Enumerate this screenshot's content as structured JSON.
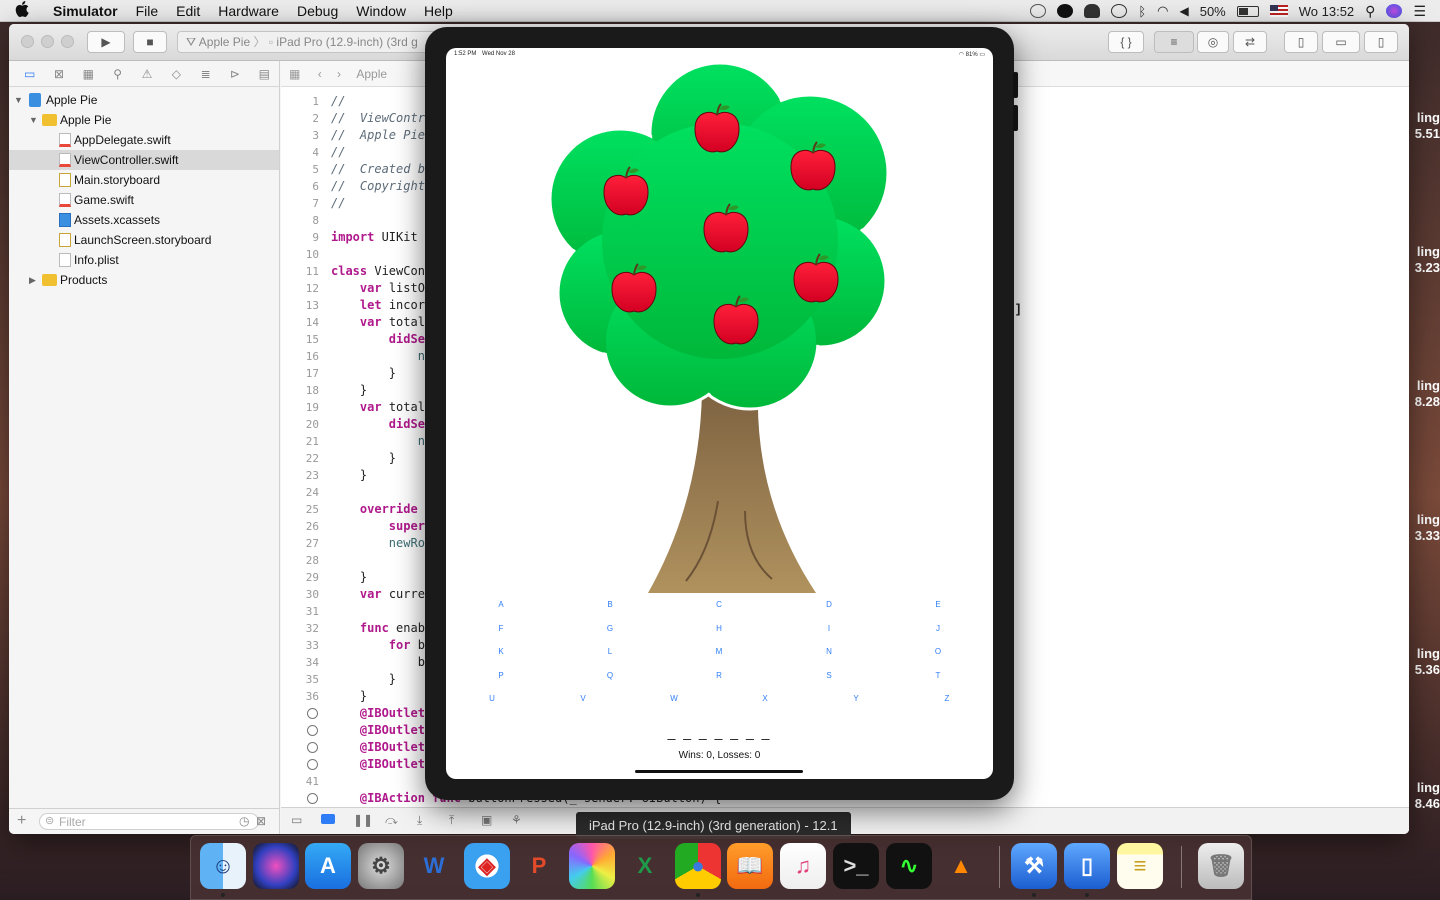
{
  "menubar": {
    "apple": "",
    "app": "Simulator",
    "items": [
      "File",
      "Edit",
      "Hardware",
      "Debug",
      "Window",
      "Help"
    ],
    "battery": "50%",
    "clock": "Wo 13:52"
  },
  "xcode": {
    "scheme": "Apple Pie",
    "device": "iPad Pro (12.9-inch) (3rd g",
    "jump_file": "Apple",
    "filter_placeholder": "Filter",
    "navigator": [
      {
        "label": "Apple Pie",
        "kind": "proj",
        "depth": 0,
        "open": true
      },
      {
        "label": "Apple Pie",
        "kind": "folder",
        "depth": 1,
        "open": true
      },
      {
        "label": "AppDelegate.swift",
        "kind": "swift",
        "depth": 2
      },
      {
        "label": "ViewController.swift",
        "kind": "swift",
        "depth": 2,
        "selected": true
      },
      {
        "label": "Main.storyboard",
        "kind": "sb",
        "depth": 2
      },
      {
        "label": "Game.swift",
        "kind": "swift",
        "depth": 2
      },
      {
        "label": "Assets.xcassets",
        "kind": "xc",
        "depth": 2
      },
      {
        "label": "LaunchScreen.storyboard",
        "kind": "sb",
        "depth": 2
      },
      {
        "label": "Info.plist",
        "kind": "plist",
        "depth": 2
      },
      {
        "label": "Products",
        "kind": "folder",
        "depth": 1,
        "open": false
      }
    ],
    "code": [
      {
        "n": "1",
        "html": "<span class='cm'>//</span>"
      },
      {
        "n": "2",
        "html": "<span class='cm'>//  ViewContr</span>"
      },
      {
        "n": "3",
        "html": "<span class='cm'>//  Apple Pie</span>"
      },
      {
        "n": "4",
        "html": "<span class='cm'>//</span>"
      },
      {
        "n": "5",
        "html": "<span class='cm'>//  Created b</span>"
      },
      {
        "n": "6",
        "html": "<span class='cm'>//  Copyright</span>"
      },
      {
        "n": "7",
        "html": "<span class='cm'>//</span>"
      },
      {
        "n": "8",
        "html": ""
      },
      {
        "n": "9",
        "html": "<span class='kw'>import</span> UIKit"
      },
      {
        "n": "10",
        "html": ""
      },
      {
        "n": "11",
        "html": "<span class='kw'>class</span> ViewCon"
      },
      {
        "n": "12",
        "html": "    <span class='kw'>var</span> listO"
      },
      {
        "n": "13",
        "html": "    <span class='kw'>let</span> incor"
      },
      {
        "n": "14",
        "html": "    <span class='kw'>var</span> total"
      },
      {
        "n": "15",
        "html": "        <span class='kw'>didSe</span>"
      },
      {
        "n": "16",
        "html": "            <span class='fn'>n</span>"
      },
      {
        "n": "17",
        "html": "        }"
      },
      {
        "n": "18",
        "html": "    }"
      },
      {
        "n": "19",
        "html": "    <span class='kw'>var</span> total"
      },
      {
        "n": "20",
        "html": "        <span class='kw'>didSe</span>"
      },
      {
        "n": "21",
        "html": "            <span class='fn'>n</span>"
      },
      {
        "n": "22",
        "html": "        }"
      },
      {
        "n": "23",
        "html": "    }"
      },
      {
        "n": "24",
        "html": ""
      },
      {
        "n": "25",
        "html": "    <span class='kw'>override</span>"
      },
      {
        "n": "26",
        "html": "        <span class='kw'>super</span>"
      },
      {
        "n": "27",
        "html": "        <span class='fn'>newRo</span>"
      },
      {
        "n": "28",
        "html": ""
      },
      {
        "n": "29",
        "html": "    }"
      },
      {
        "n": "30",
        "html": "    <span class='kw'>var</span> curre"
      },
      {
        "n": "31",
        "html": ""
      },
      {
        "n": "32",
        "html": "    <span class='kw'>func</span> enab"
      },
      {
        "n": "33",
        "html": "        <span class='kw'>for</span> b"
      },
      {
        "n": "34",
        "html": "            b"
      },
      {
        "n": "35",
        "html": "        }"
      },
      {
        "n": "36",
        "html": "    }"
      },
      {
        "n": "",
        "dot": true,
        "html": "    <span class='kw'>@IBOutlet</span>"
      },
      {
        "n": "",
        "dot": true,
        "html": "    <span class='kw'>@IBOutlet</span>"
      },
      {
        "n": "",
        "dot": true,
        "html": "    <span class='kw'>@IBOutlet</span>"
      },
      {
        "n": "",
        "dot": true,
        "html": "    <span class='kw'>@IBOutlet</span>"
      },
      {
        "n": "41",
        "html": ""
      },
      {
        "n": "",
        "dot": true,
        "html": "    <span class='kw'>@IBAction</span> <span class='kw'>func</span> buttonPressed(_ sender: UIButton) {"
      }
    ],
    "right_fragment": "]"
  },
  "simulator": {
    "status_time": "1:52 PM",
    "status_date": "Wed Nov 28",
    "status_battery": "81%",
    "letters": [
      "A",
      "B",
      "C",
      "D",
      "E",
      "F",
      "G",
      "H",
      "I",
      "J",
      "K",
      "L",
      "M",
      "N",
      "O",
      "P",
      "Q",
      "R",
      "S",
      "T",
      "U",
      "V",
      "W",
      "X",
      "Y",
      "Z"
    ],
    "word": "_ _ _ _ _ _ _",
    "score": "Wins: 0, Losses: 0",
    "tooltip": "iPad Pro (12.9-inch) (3rd generation) - 12.1"
  },
  "background_clips": [
    {
      "a": "ling",
      "b": "5.51"
    },
    {
      "a": "ling",
      "b": "3.23"
    },
    {
      "a": "ling",
      "b": "8.28"
    },
    {
      "a": "ling",
      "b": "3.33"
    },
    {
      "a": "ling",
      "b": "5.36"
    },
    {
      "a": "ling",
      "b": "8.46"
    }
  ],
  "dock": [
    "finder-icon",
    "siri-icon",
    "app-store-icon",
    "system-preferences-icon",
    "word-icon",
    "safari-icon",
    "powerpoint-icon",
    "photos-icon",
    "excel-icon",
    "chrome-icon",
    "ibooks-icon",
    "itunes-icon",
    "terminal-icon",
    "activity-monitor-icon",
    "vlc-icon",
    "xcode-icon",
    "simulator-icon",
    "notes-icon",
    "trash-icon"
  ]
}
